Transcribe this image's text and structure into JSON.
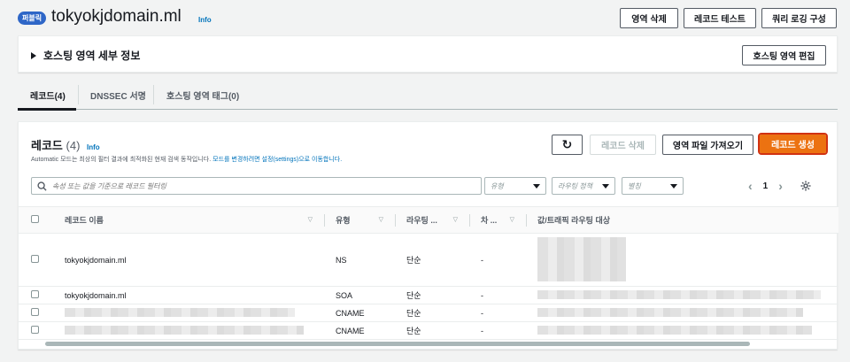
{
  "header": {
    "badge": "퍼블릭",
    "zone_name": "tokyokjdomain.ml",
    "info": "Info",
    "buttons": {
      "delete_zone": "영역 삭제",
      "test_record": "레코드 테스트",
      "query_logging": "쿼리 로깅 구성"
    }
  },
  "details": {
    "title": "호스팅 영역 세부 정보",
    "edit_button": "호스팅 영역 편집"
  },
  "tabs": [
    {
      "label": "레코드(4)",
      "active": true
    },
    {
      "label": "DNSSEC 서명",
      "active": false
    },
    {
      "label": "호스팅 영역 태그(0)",
      "active": false
    }
  ],
  "records": {
    "title": "레코드",
    "count": "(4)",
    "info": "Info",
    "description_prefix": "Automatic 모드는 최상의 필터 결과에 최적화된 현재 검색 동작입니다.",
    "description_link": "모드를 변경하려면 설정(settings)으로 이동합니다.",
    "buttons": {
      "refresh": "↻",
      "delete": "레코드 삭제",
      "import": "영역 파일 가져오기",
      "create": "레코드 생성"
    },
    "search_placeholder": "속성 또는 값을 기준으로 레코드 필터링",
    "filters": {
      "type": "유형",
      "routing": "라우팅 정책",
      "alias": "별칭"
    },
    "page": "1",
    "columns": [
      "레코드 이름",
      "유형",
      "라우팅 ...",
      "차 ...",
      "값/트래픽 라우팅 대상"
    ],
    "rows": [
      {
        "name": "tokyokjdomain.ml",
        "type": "NS",
        "routing": "단순",
        "diff": "-"
      },
      {
        "name": "tokyokjdomain.ml",
        "type": "SOA",
        "routing": "단순",
        "diff": "-"
      },
      {
        "name": "",
        "type": "CNAME",
        "routing": "단순",
        "diff": "-"
      },
      {
        "name": "",
        "type": "CNAME",
        "routing": "단순",
        "diff": "-"
      }
    ]
  },
  "icons": {
    "refresh": "refresh-icon",
    "search": "search-icon",
    "settings": "gear-icon"
  },
  "colors": {
    "primary": "#ec7211",
    "link": "#0073bb",
    "badge": "#2e66c7"
  }
}
